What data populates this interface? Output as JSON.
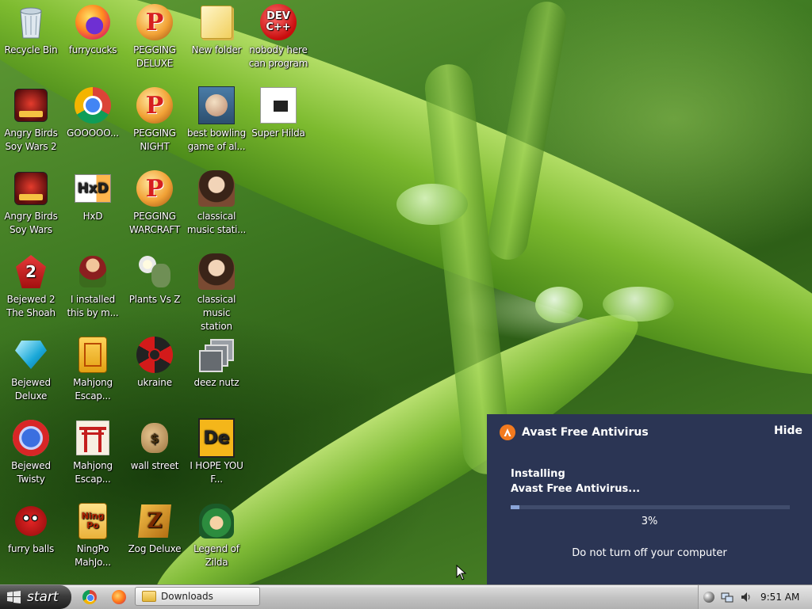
{
  "desktop": {
    "icons": [
      {
        "label": "Recycle Bin",
        "icon": "recycle-bin-icon"
      },
      {
        "label": "furrycucks",
        "icon": "firefox-icon"
      },
      {
        "label": "PEGGING DELUXE",
        "icon": "peggle-icon"
      },
      {
        "label": "New folder",
        "icon": "folder-icon"
      },
      {
        "label": "nobody here can program",
        "icon": "devcpp-icon"
      },
      {
        "label": "Angry Birds Soy Wars 2",
        "icon": "angry-birds-star-wars-icon"
      },
      {
        "label": "GOOOOO...",
        "icon": "chrome-icon"
      },
      {
        "label": "PEGGING NIGHT",
        "icon": "peggle-icon"
      },
      {
        "label": "best bowling game of al...",
        "icon": "bowling-game-icon"
      },
      {
        "label": "Super Hilda",
        "icon": "pixel-cat-icon"
      },
      {
        "label": "Angry Birds Soy Wars",
        "icon": "angry-birds-star-wars-icon"
      },
      {
        "label": "HxD",
        "icon": "hxd-icon"
      },
      {
        "label": "PEGGING WARCRAFT",
        "icon": "peggle-icon"
      },
      {
        "label": "classical music stati...",
        "icon": "portrait-icon"
      },
      {
        "label": "Bejewed 2 The Shoah",
        "icon": "bejeweled-2-icon"
      },
      {
        "label": "I installed this by m...",
        "icon": "character-icon"
      },
      {
        "label": "Plants Vs Z",
        "icon": "plants-vs-zombies-icon"
      },
      {
        "label": "classical music station",
        "icon": "portrait-icon"
      },
      {
        "label": "Bejewed Deluxe",
        "icon": "diamond-icon"
      },
      {
        "label": "Mahjong Escap...",
        "icon": "mahjong-tile-icon"
      },
      {
        "label": "ukraine",
        "icon": "radiation-icon"
      },
      {
        "label": "deez nutz",
        "icon": "windows-stack-icon"
      },
      {
        "label": "Bejewed Twisty",
        "icon": "bejeweled-twist-icon"
      },
      {
        "label": "Mahjong Escap...",
        "icon": "torii-gate-icon"
      },
      {
        "label": "wall street",
        "icon": "money-bag-icon"
      },
      {
        "label": "I HOPE YOU F...",
        "icon": "de-logo-icon"
      },
      {
        "label": "furry balls",
        "icon": "red-fuzzball-icon"
      },
      {
        "label": "NingPo MahJo...",
        "icon": "ningpo-mahjong-icon"
      },
      {
        "label": "Zog Deluxe",
        "icon": "zuma-icon"
      },
      {
        "label": "Legend of Zilda",
        "icon": "zelda-link-icon"
      }
    ],
    "icon_texts": {
      "devcpp": "DEV\nC++",
      "hxd": "HxD",
      "de": "De",
      "ningpo": "Ning\nPo"
    }
  },
  "avast": {
    "title": "Avast Free Antivirus",
    "hide_label": "Hide",
    "status_line1": "Installing",
    "status_line2": "Avast Free Antivirus...",
    "progress": 0.03,
    "percent_text": "3%",
    "warning": "Do not turn off your computer",
    "colors": {
      "background": "#2b3554",
      "accent": "#f37a1f"
    }
  },
  "taskbar": {
    "start_label": "start",
    "quick_launch": [
      {
        "icon": "chrome-icon"
      },
      {
        "icon": "firefox-icon"
      }
    ],
    "tasks": [
      {
        "label": "Downloads",
        "icon": "folder-icon"
      }
    ],
    "tray": {
      "icons": [
        "avast-tray-icon",
        "network-icon",
        "volume-icon"
      ],
      "clock": "9:51 AM"
    }
  }
}
